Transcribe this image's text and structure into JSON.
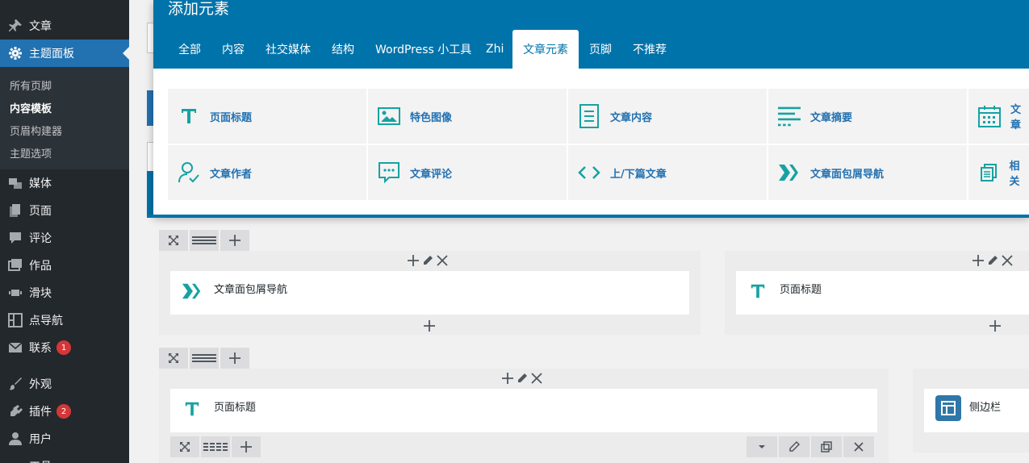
{
  "sidebar": {
    "items": [
      {
        "label": "文章",
        "icon": "pushpin-icon"
      },
      {
        "label": "主题面板",
        "icon": "gear-icon",
        "active": true
      },
      {
        "label": "媒体",
        "icon": "media-icon"
      },
      {
        "label": "页面",
        "icon": "page-icon"
      },
      {
        "label": "评论",
        "icon": "comment-icon"
      },
      {
        "label": "作品",
        "icon": "portfolio-icon"
      },
      {
        "label": "滑块",
        "icon": "slider-icon"
      },
      {
        "label": "点导航",
        "icon": "dot-nav-icon"
      },
      {
        "label": "联系",
        "icon": "mail-icon",
        "badge": "1"
      },
      {
        "label": "外观",
        "icon": "brush-icon"
      },
      {
        "label": "插件",
        "icon": "plugin-icon",
        "badge": "2"
      },
      {
        "label": "用户",
        "icon": "user-icon"
      },
      {
        "label": "工具",
        "icon": "tools-icon"
      }
    ],
    "submenu": [
      "所有页脚",
      "内容模板",
      "页眉构建器",
      "主题选项"
    ]
  },
  "modal": {
    "title": "添加元素",
    "tabs": [
      "全部",
      "内容",
      "社交媒体",
      "结构",
      "WordPress 小工具",
      "Zhi",
      "文章元素",
      "页脚",
      "不推荐"
    ],
    "active_tab": "文章元素",
    "elements": [
      {
        "label": "页面标题",
        "icon": "title-t-icon"
      },
      {
        "label": "特色图像",
        "icon": "image-icon"
      },
      {
        "label": "文章内容",
        "icon": "document-icon"
      },
      {
        "label": "文章摘要",
        "icon": "excerpt-icon"
      },
      {
        "label": "文章",
        "icon": "calendar-icon"
      },
      {
        "label": "文章作者",
        "icon": "author-icon"
      },
      {
        "label": "文章评论",
        "icon": "comments-icon"
      },
      {
        "label": "上/下篇文章",
        "icon": "code-arrows-icon"
      },
      {
        "label": "文章面包屑导航",
        "icon": "breadcrumb-icon"
      },
      {
        "label": "相关",
        "icon": "related-icon"
      }
    ]
  },
  "builder": {
    "row1": {
      "col1_module": "文章面包屑导航",
      "col2_module": "页面标题"
    },
    "row2": {
      "col1_module": "页面标题",
      "col2_module": "侧边栏"
    }
  },
  "colors": {
    "admin_bar": "#23282d",
    "accent": "#0073aa",
    "icon_teal": "#16a2a2"
  }
}
